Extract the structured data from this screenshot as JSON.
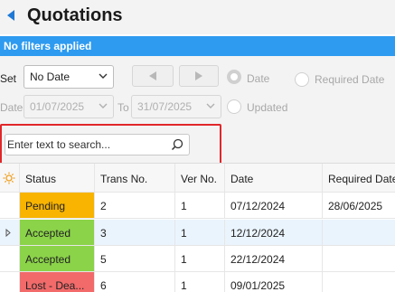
{
  "title": "Quotations",
  "filter_status": "No filters applied",
  "filters": {
    "set_label": "Set",
    "set_value": "No Date",
    "date_label": "Date",
    "date_from": "01/07/2025",
    "to_label": "To",
    "date_to": "31/07/2025",
    "radio_date": "Date",
    "radio_required_date": "Required Date",
    "radio_updated": "Updated"
  },
  "search": {
    "placeholder": "Enter text to search..."
  },
  "table": {
    "columns": [
      "Status",
      "Trans No.",
      "Ver No.",
      "Date",
      "Required Date"
    ],
    "rows": [
      {
        "status": "Pending",
        "status_color": "#f8b400",
        "trans_no": "2",
        "ver_no": "1",
        "date": "07/12/2024",
        "required_date": "28/06/2025"
      },
      {
        "status": "Accepted",
        "status_color": "#8bd349",
        "trans_no": "3",
        "ver_no": "1",
        "date": "12/12/2024",
        "required_date": ""
      },
      {
        "status": "Accepted",
        "status_color": "#8bd349",
        "trans_no": "5",
        "ver_no": "1",
        "date": "22/12/2024",
        "required_date": ""
      },
      {
        "status": "Lost - Dea...",
        "status_color": "#f26a6a",
        "trans_no": "6",
        "ver_no": "1",
        "date": "09/01/2025",
        "required_date": ""
      }
    ]
  },
  "colors": {
    "accent": "#2e9bf0",
    "highlight": "#e0262a"
  },
  "icons": {
    "back": "back-arrow-icon",
    "search": "search-icon",
    "settings": "sun-settings-icon"
  }
}
